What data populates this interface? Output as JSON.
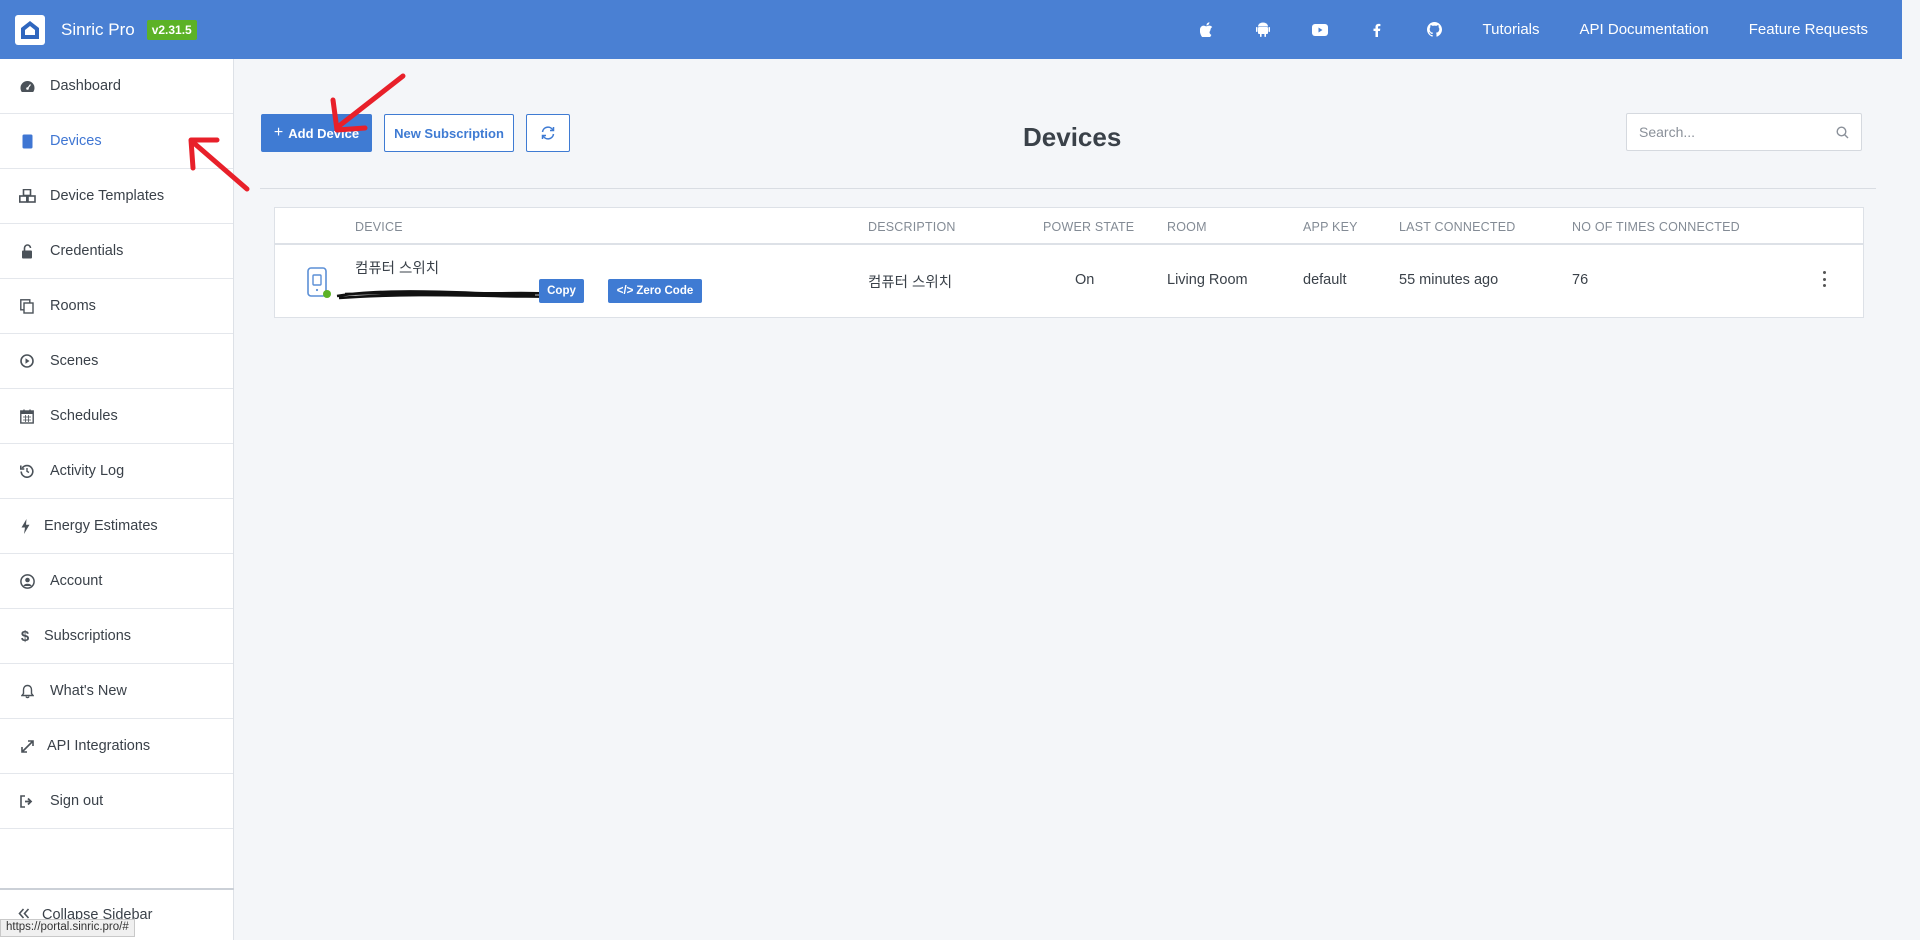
{
  "header": {
    "brand": "Sinric Pro",
    "version": "v2.31.5",
    "icons": [
      "apple-icon",
      "android-icon",
      "youtube-icon",
      "facebook-icon",
      "github-icon"
    ],
    "links": [
      "Tutorials",
      "API Documentation",
      "Feature Requests"
    ]
  },
  "sidebar": {
    "items": [
      {
        "label": "Dashboard",
        "icon": "dashboard-icon"
      },
      {
        "label": "Devices",
        "icon": "tablet-icon",
        "active": true
      },
      {
        "label": "Device Templates",
        "icon": "cubes-icon"
      },
      {
        "label": "Credentials",
        "icon": "unlock-icon"
      },
      {
        "label": "Rooms",
        "icon": "copy-icon"
      },
      {
        "label": "Scenes",
        "icon": "play-circle-icon"
      },
      {
        "label": "Schedules",
        "icon": "calendar-icon"
      },
      {
        "label": "Activity Log",
        "icon": "history-icon"
      },
      {
        "label": "Energy Estimates",
        "icon": "bolt-icon"
      },
      {
        "label": "Account",
        "icon": "user-circle-icon"
      },
      {
        "label": "Subscriptions",
        "icon": "dollar-icon"
      },
      {
        "label": "What's New",
        "icon": "bell-icon"
      },
      {
        "label": "API Integrations",
        "icon": "expand-icon"
      },
      {
        "label": "Sign out",
        "icon": "sign-out-icon"
      }
    ],
    "collapse_label": "Collapse Sidebar"
  },
  "main": {
    "add_device_label": "Add Device",
    "new_subscription_label": "New Subscription",
    "title": "Devices",
    "search_placeholder": "Search...",
    "columns": [
      "DEVICE",
      "DESCRIPTION",
      "POWER STATE",
      "ROOM",
      "APP KEY",
      "LAST CONNECTED",
      "NO OF TIMES CONNECTED"
    ],
    "rows": [
      {
        "name": "컴퓨터 스위치",
        "copy_label": "Copy",
        "zero_code_label": "Zero Code",
        "description": "컴퓨터 스위치",
        "power_state": "On",
        "room": "Living Room",
        "app_key": "default",
        "last_connected": "55 minutes ago",
        "times_connected": "76"
      }
    ]
  },
  "status_url": "https://portal.sinric.pro/#",
  "colors": {
    "primary": "#4a80d3",
    "accent": "#3f7bd3",
    "badge": "#5cb226",
    "annotation": "#e8202a"
  }
}
